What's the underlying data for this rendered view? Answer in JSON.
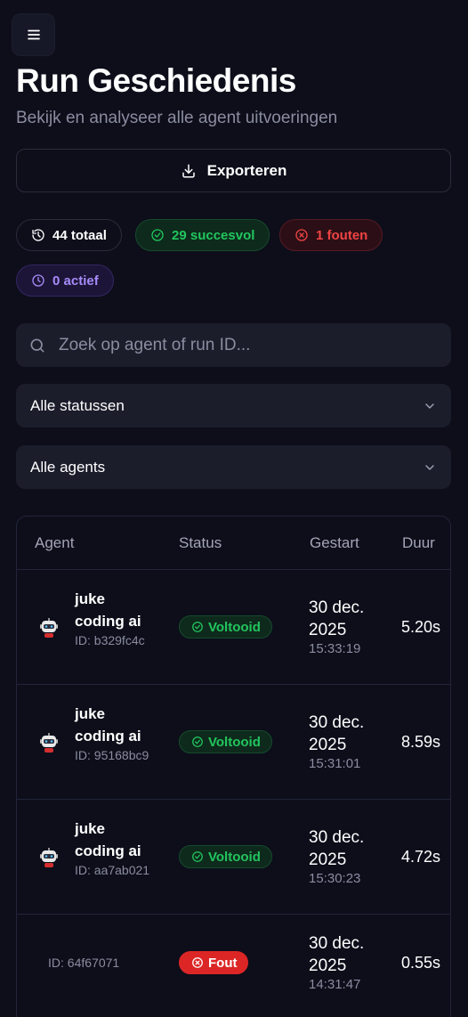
{
  "header": {
    "title": "Run Geschiedenis",
    "subtitle": "Bekijk en analyseer alle agent uitvoeringen"
  },
  "actions": {
    "export_label": "Exporteren"
  },
  "stats": {
    "total": "44 totaal",
    "success": "29 succesvol",
    "errors": "1 fouten",
    "active": "0 actief"
  },
  "filters": {
    "search_placeholder": "Zoek op agent of run ID...",
    "status_select": "Alle statussen",
    "agent_select": "Alle agents"
  },
  "table": {
    "columns": {
      "agent": "Agent",
      "status": "Status",
      "started": "Gestart",
      "duration": "Duur"
    },
    "rows": [
      {
        "agent": "juke coding ai",
        "id": "ID: b329fc4c",
        "status": "Voltooid",
        "date": "30 dec. 2025",
        "time": "15:33:19",
        "duration": "5.20s"
      },
      {
        "agent": "juke coding ai",
        "id": "ID: 95168bc9",
        "status": "Voltooid",
        "date": "30 dec. 2025",
        "time": "15:31:01",
        "duration": "8.59s"
      },
      {
        "agent": "juke coding ai",
        "id": "ID: aa7ab021",
        "status": "Voltooid",
        "date": "30 dec. 2025",
        "time": "15:30:23",
        "duration": "4.72s"
      },
      {
        "agent": "",
        "id": "ID: 64f67071",
        "status": "Fout",
        "date": "30 dec. 2025",
        "time": "14:31:47",
        "duration": "0.55s"
      }
    ]
  },
  "colors": {
    "background": "#0d0e1a",
    "success": "#22c55e",
    "error": "#ef4444",
    "active": "#a78bfa"
  },
  "icons": {
    "menu": "menu-icon",
    "export": "download-icon",
    "total": "history-icon",
    "success": "check-circle-icon",
    "error": "x-circle-icon",
    "active": "clock-icon",
    "search": "search-icon",
    "chevron": "chevron-down-icon",
    "agent": "robot-icon"
  }
}
